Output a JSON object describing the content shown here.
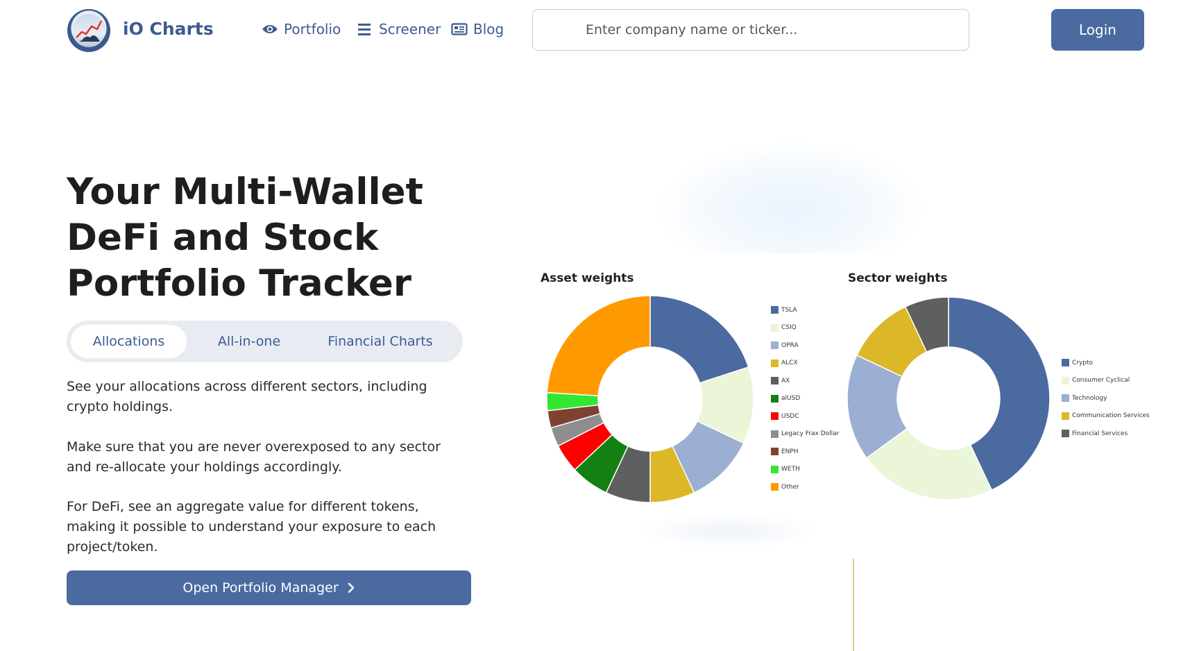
{
  "header": {
    "brand": "iO Charts",
    "nav": [
      {
        "label": "Portfolio",
        "icon": "eye-icon"
      },
      {
        "label": "Screener",
        "icon": "list-icon"
      },
      {
        "label": "Blog",
        "icon": "newspaper-icon"
      }
    ],
    "search_placeholder": "Enter company name or ticker...",
    "login_label": "Login"
  },
  "hero": {
    "title_lines": [
      "Your Multi-Wallet",
      "DeFi and Stock",
      "Portfolio Tracker"
    ],
    "tabs": [
      "Allocations",
      "All-in-one",
      "Financial Charts"
    ],
    "active_tab": "Allocations",
    "paragraphs": [
      "See your allocations across different sectors, including crypto holdings.",
      "Make sure that you are never overexposed to any sector and re-allocate your holdings accordingly.",
      "For DeFi, see an aggregate value for different tokens, making it possible to understand your exposure to each project/token."
    ],
    "cta_label": "Open Portfolio Manager"
  },
  "chart_data": [
    {
      "type": "pie",
      "title": "Asset weights",
      "categories": [
        "TSLA",
        "CSIQ",
        "OPRA",
        "ALCX",
        "AX",
        "alUSD",
        "USDC",
        "Legacy Frax Dollar",
        "ENPH",
        "WETH",
        "Other"
      ],
      "values": [
        20,
        12,
        11,
        7,
        7,
        6,
        4.5,
        3,
        2.7,
        2.8,
        24
      ],
      "colors": [
        "#4a6aa0",
        "#ebf5d8",
        "#9aafd2",
        "#dcb828",
        "#5f5f5f",
        "#128012",
        "#ff0000",
        "#8e8e8e",
        "#7f4232",
        "#33e633",
        "#ff9900"
      ],
      "legend": "right"
    },
    {
      "type": "pie",
      "title": "Sector weights",
      "categories": [
        "Crypto",
        "Consumer Cyclical",
        "Technology",
        "Communication Services",
        "Financial Services"
      ],
      "values": [
        43,
        22,
        17,
        11,
        7
      ],
      "colors": [
        "#4a6aa0",
        "#ebf5d8",
        "#9aafd2",
        "#dcb828",
        "#5f5f5f"
      ],
      "legend": "right"
    }
  ]
}
